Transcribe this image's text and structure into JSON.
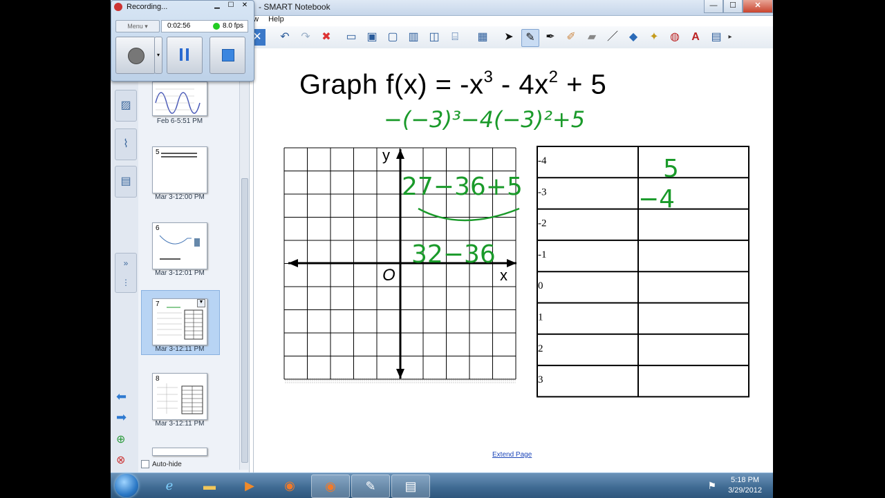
{
  "window": {
    "title": "- SMART Notebook",
    "min": "—",
    "max": "☐",
    "close": "✕"
  },
  "menubar": [
    "aw",
    "Help"
  ],
  "recorder": {
    "title": "Recording...",
    "menu_label": "Menu",
    "elapsed": "0:02:56",
    "fps": "8.0 fps",
    "status_color": "#22cc22"
  },
  "sidebar": {
    "pages": [
      {
        "label": "Feb 6-5:51 PM",
        "number": ""
      },
      {
        "label": "Mar 3-12:00 PM",
        "number": "5"
      },
      {
        "label": "Mar 3-12:01 PM",
        "number": "6"
      },
      {
        "label": "Mar 3-12:11 PM",
        "number": "7"
      },
      {
        "label": "Mar 3-12:11 PM",
        "number": "8"
      }
    ],
    "autohide_label": "Auto-hide"
  },
  "canvas": {
    "title_main": "Graph f(x) = -x",
    "title_exp1": "3",
    "title_mid": " - 4x",
    "title_exp2": "2",
    "title_end": " + 5",
    "axis_x": "x",
    "axis_y": "y",
    "origin": "O",
    "table_x_values": [
      "-4",
      "-3",
      "-2",
      "-1",
      "0",
      "1",
      "2",
      "3"
    ],
    "handwriting": {
      "line1": "−(−3)³−4(−3)²+5",
      "line2": "27−36+5",
      "line3": "32−36",
      "val1": "5",
      "val2": "−4"
    },
    "extend_link": "Extend Page",
    "ink_color": "#1a9a2a"
  },
  "taskbar": {
    "time": "5:18 PM",
    "date": "3/29/2012"
  }
}
